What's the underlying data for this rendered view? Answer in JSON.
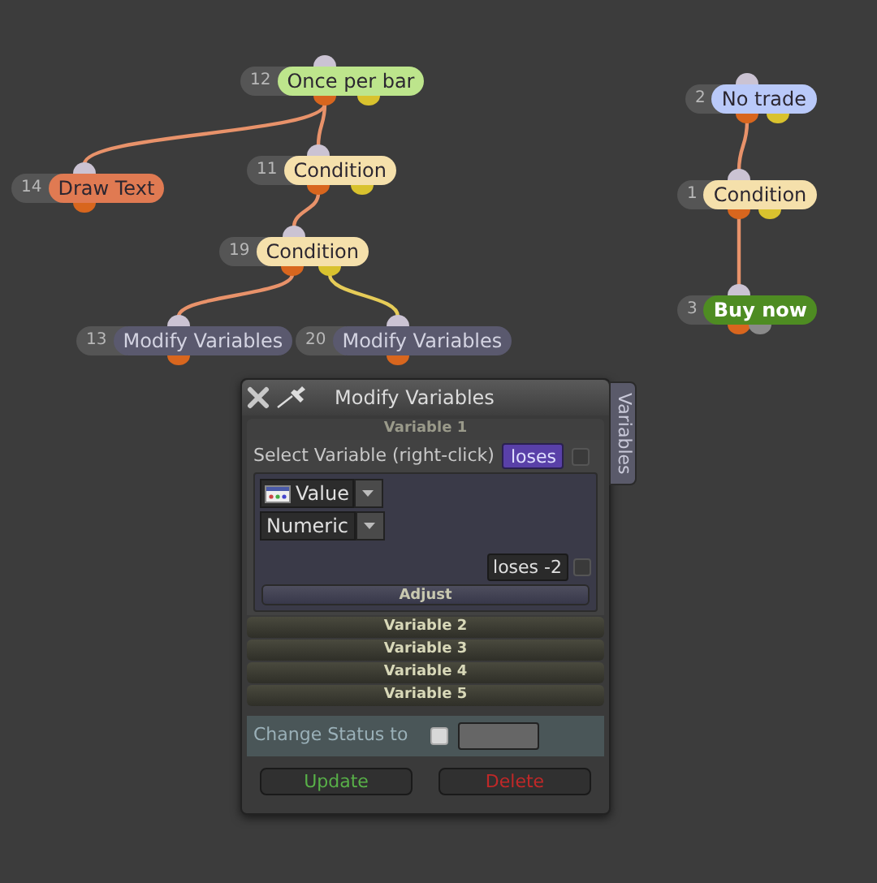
{
  "nodes": [
    {
      "number": "12",
      "label": "Once per bar",
      "color": "#bde58c"
    },
    {
      "number": "14",
      "label": "Draw Text",
      "color": "#e07a52"
    },
    {
      "number": "11",
      "label": "Condition",
      "color": "#f5e0ab"
    },
    {
      "number": "19",
      "label": "Condition",
      "color": "#f5e0ab"
    },
    {
      "number": "13",
      "label": "Modify Variables",
      "color": "#5a596e"
    },
    {
      "number": "20",
      "label": "Modify Variables",
      "color": "#5a596e"
    },
    {
      "number": "2",
      "label": "No trade",
      "color": "#b9c9f9"
    },
    {
      "number": "1",
      "label": "Condition",
      "color": "#f5e0ab"
    },
    {
      "number": "3",
      "label": "Buy now",
      "color": "#4e8c22"
    }
  ],
  "panel": {
    "title": "Modify Variables",
    "side_tab": "Variables",
    "sections": [
      {
        "title": "Variable 1",
        "expanded": true,
        "select_label": "Select Variable (right-click)",
        "variable": "loses",
        "variable_checked": false,
        "type": "Value",
        "format": "Numeric",
        "value": "loses -2",
        "value_checked": false,
        "action": "Adjust"
      },
      {
        "title": "Variable 2",
        "expanded": false
      },
      {
        "title": "Variable 3",
        "expanded": false
      },
      {
        "title": "Variable 4",
        "expanded": false
      },
      {
        "title": "Variable 5",
        "expanded": false
      }
    ],
    "status_label": "Change Status to",
    "status_checked": false,
    "buttons": [
      {
        "label": "Update",
        "kind": "update"
      },
      {
        "label": "Delete",
        "kind": "delete"
      }
    ]
  }
}
